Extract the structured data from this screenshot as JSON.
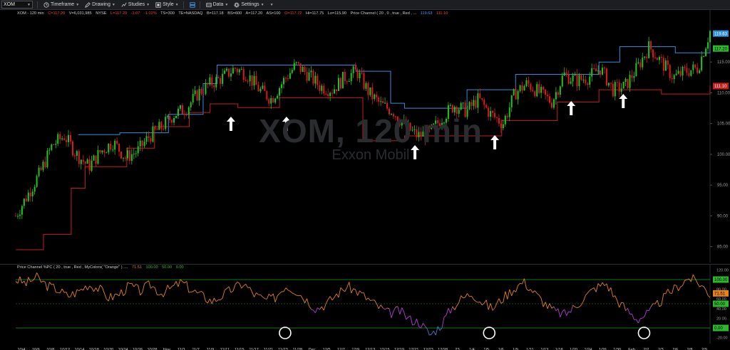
{
  "toolbar": {
    "symbol": "XOM",
    "items": [
      "Timeframe",
      "Drawing",
      "Studies",
      "Style",
      "Data",
      "Settings"
    ]
  },
  "header": {
    "name": "XOM - 120 min",
    "close": "C=117.20",
    "volume": "V=6,031,985",
    "exchange": "NYSE",
    "low": "L=117.20",
    "change": "-1.07",
    "change_pct": "-1.02%",
    "ts": "TS=300",
    "te": "TE=NASDAQ",
    "bid": "B=117.18",
    "bid_size": "BS=600",
    "ask": "A=117.20",
    "ask_size": "AS=100",
    "open": "O=117.72",
    "high": "Hi=117.75",
    "lo": "Lo=115.90",
    "study": "Price Channel ( 20 , 0 , true , Red , ...",
    "upper_value": "119.63",
    "lower_value": "111.10"
  },
  "watermark": {
    "symbol": "XOM, 120 min",
    "company": "Exxon Mobil"
  },
  "price_axis": {
    "ticks": [
      "115.00",
      "110.00",
      "105.00",
      "100.00",
      "95.00",
      "90.00",
      "85.00"
    ],
    "tags": {
      "upper": "119.63",
      "last": "117.20",
      "lower": "111.10"
    }
  },
  "oscillator": {
    "title": "Price Channel %PC ( 20 , true , Red , MyColors( \"Orange\" ) ....",
    "value": "71.51",
    "levels": [
      "100.00",
      "50.00",
      "0.00"
    ],
    "axis_ticks": [
      "120.00",
      "100.00",
      "80.00",
      "60.00",
      "40.00",
      "20.00",
      "0.00",
      "-20.00"
    ],
    "tags": {
      "top": "100.00",
      "value": "71.51",
      "mid": "50.00",
      "bottom": "0.00"
    }
  },
  "dates": [
    "10/4",
    "10/6",
    "10/8",
    "10/12",
    "10/14",
    "10/18",
    "10/20",
    "10/24",
    "10/26",
    "10/28",
    "Nov",
    "11/3",
    "11/7",
    "11/9",
    "11/11",
    "11/15",
    "11/17",
    "11/21",
    "11/23",
    "11/28",
    "Dec",
    "12/5",
    "12/7",
    "12/9",
    "12/13",
    "12/15",
    "12/19",
    "12/21",
    "12/23",
    "12/28",
    "23",
    "1/4",
    "1/5",
    "1/6",
    "1/9",
    "1/11",
    "1/13",
    "1/18",
    "1/20",
    "1/24",
    "1/26",
    "1/30",
    "Feb",
    "2/2",
    "2/3",
    "2/6",
    "2/8",
    "2/9"
  ],
  "colors": {
    "background": "#000000",
    "candle_up": "#22c422",
    "candle_down": "#e01818",
    "upper_channel": "#2f8fdc",
    "lower_channel": "#c81e1e",
    "osc_line": "#e6821e",
    "osc_low": "#b040d8",
    "osc_neg": "#3b7fd0",
    "osc_levels": "#1e9c1e"
  },
  "chart_data": {
    "type": "candlestick",
    "symbol": "XOM",
    "interval": "120 min",
    "ylim": [
      83,
      123
    ],
    "close_path": [
      90.0,
      93.5,
      97.0,
      101.5,
      103.0,
      100.0,
      98.0,
      100.5,
      102.0,
      99.5,
      100.5,
      103.0,
      104.5,
      106.5,
      107.5,
      110.0,
      111.5,
      112.5,
      114.0,
      113.0,
      110.5,
      109.0,
      112.0,
      114.5,
      113.0,
      111.0,
      110.5,
      112.5,
      113.5,
      110.0,
      108.0,
      107.0,
      104.5,
      103.0,
      103.5,
      106.0,
      108.0,
      107.0,
      109.0,
      106.5,
      105.0,
      110.0,
      111.5,
      110.0,
      108.5,
      113.0,
      112.0,
      112.5,
      114.0,
      110.5,
      111.0,
      114.0,
      117.5,
      115.0,
      112.5,
      113.5,
      114.0,
      120.0
    ],
    "upper_channel_steps": [
      [
        0,
        0
      ],
      [
        0.09,
        103.2
      ],
      [
        0.15,
        103.5
      ],
      [
        0.22,
        106.5
      ],
      [
        0.27,
        111.5
      ],
      [
        0.29,
        114.5
      ],
      [
        0.49,
        113.5
      ],
      [
        0.54,
        108.3
      ],
      [
        0.56,
        107.5
      ],
      [
        0.65,
        110.5
      ],
      [
        0.72,
        113.0
      ],
      [
        0.84,
        115.0
      ],
      [
        0.87,
        117.5
      ],
      [
        0.95,
        116.5
      ],
      [
        1.0,
        119.6
      ]
    ],
    "lower_channel_steps": [
      [
        0,
        84.5
      ],
      [
        0.04,
        87.0
      ],
      [
        0.08,
        94.5
      ],
      [
        0.1,
        98.0
      ],
      [
        0.16,
        101.0
      ],
      [
        0.2,
        104.5
      ],
      [
        0.25,
        106.8
      ],
      [
        0.28,
        108.2
      ],
      [
        0.32,
        107.6
      ],
      [
        0.38,
        109.2
      ],
      [
        0.5,
        102.2
      ],
      [
        0.56,
        103.0
      ],
      [
        0.7,
        105.5
      ],
      [
        0.78,
        108.5
      ],
      [
        0.84,
        110.5
      ],
      [
        0.93,
        109.8
      ],
      [
        1.0,
        111.1
      ]
    ],
    "oscillator_path": [
      100,
      92,
      105,
      88,
      80,
      66,
      75,
      90,
      82,
      62,
      70,
      88,
      76,
      90,
      72,
      82,
      95,
      78,
      66,
      55,
      68,
      82,
      92,
      70,
      58,
      62,
      88,
      78,
      60,
      40,
      50,
      70,
      86,
      75,
      60,
      44,
      30,
      36,
      18,
      12,
      -15,
      5,
      40,
      60,
      72,
      54,
      40,
      62,
      80,
      96,
      74,
      52,
      34,
      28,
      44,
      66,
      84,
      92,
      58,
      36,
      18,
      30,
      50,
      72,
      88,
      104,
      92,
      70
    ],
    "signal_arrows": [
      0.31,
      0.39,
      0.575,
      0.69,
      0.8,
      0.875
    ],
    "circled_lows": [
      0.388,
      0.682,
      0.905
    ]
  }
}
